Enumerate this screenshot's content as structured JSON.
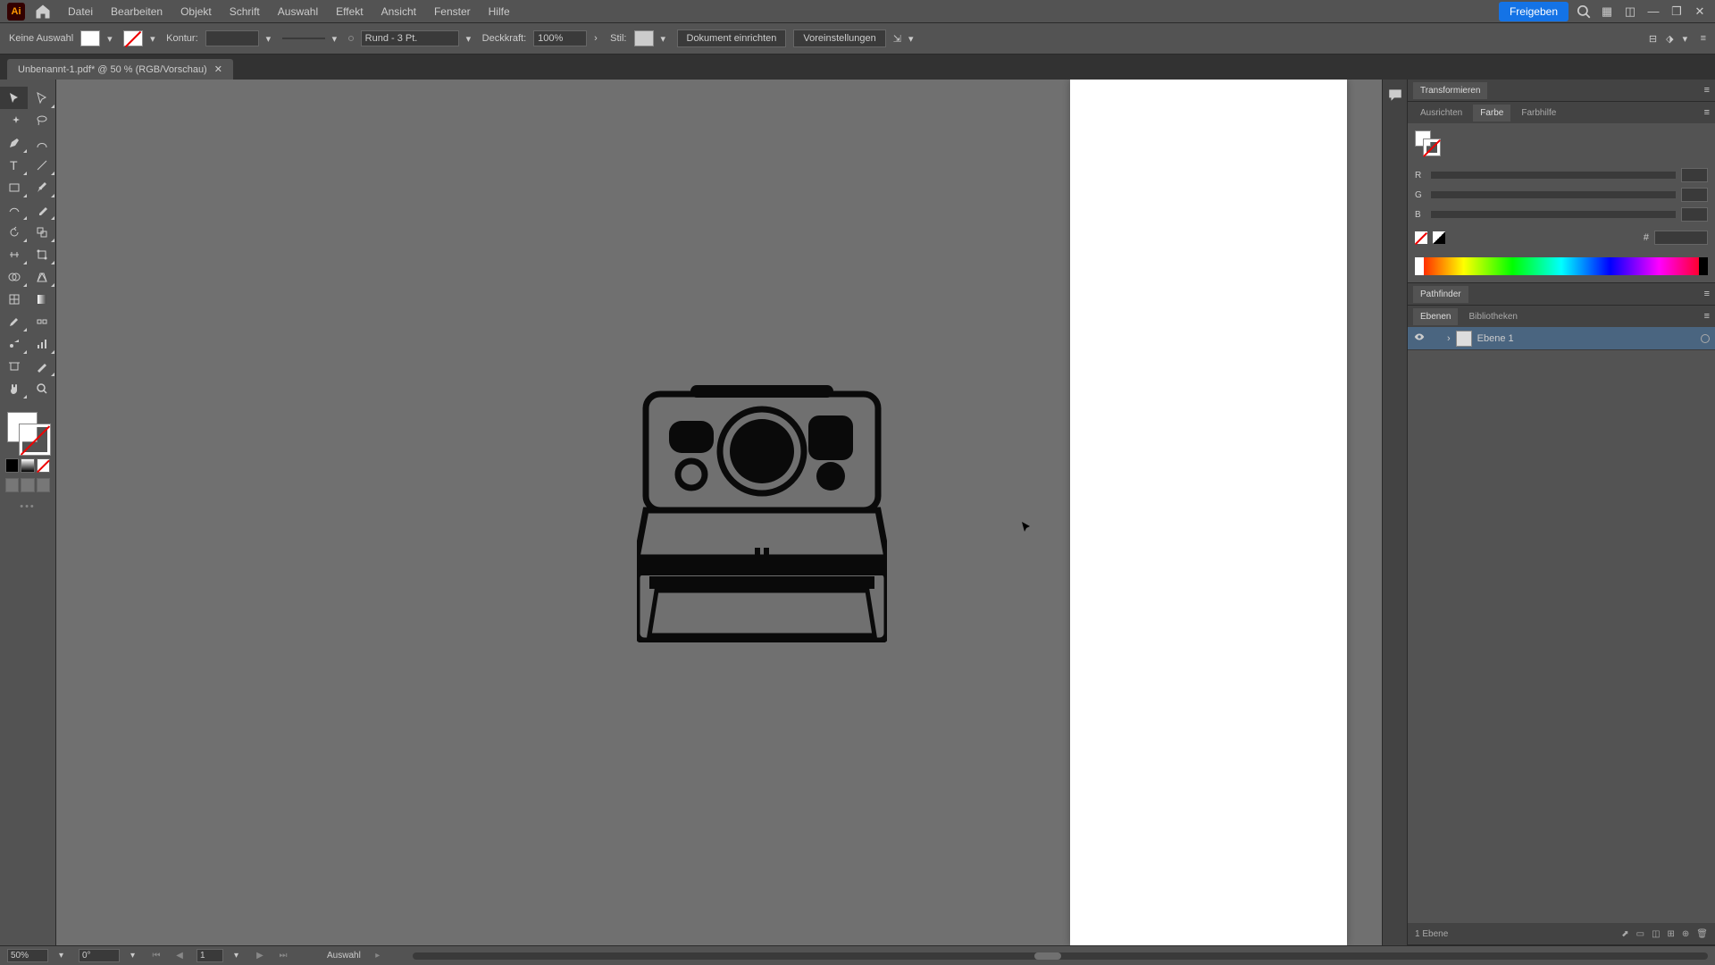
{
  "menubar": {
    "app_abbr": "Ai",
    "items": [
      "Datei",
      "Bearbeiten",
      "Objekt",
      "Schrift",
      "Auswahl",
      "Effekt",
      "Ansicht",
      "Fenster",
      "Hilfe"
    ],
    "share_label": "Freigeben"
  },
  "controlbar": {
    "selection_label": "Keine Auswahl",
    "stroke_label": "Kontur:",
    "brush_value": "Rund - 3 Pt.",
    "opacity_label": "Deckkraft:",
    "opacity_value": "100%",
    "style_label": "Stil:",
    "doc_setup": "Dokument einrichten",
    "preferences": "Voreinstellungen"
  },
  "doc": {
    "tab_title": "Unbenannt-1.pdf* @ 50 % (RGB/Vorschau)"
  },
  "panels": {
    "transform_title": "Transformieren",
    "align_tab": "Ausrichten",
    "color_tab": "Farbe",
    "color_guide_tab": "Farbhilfe",
    "rgb": {
      "r": "R",
      "g": "G",
      "b": "B"
    },
    "hex_symbol": "#",
    "pathfinder_title": "Pathfinder",
    "layers_tab": "Ebenen",
    "libraries_tab": "Bibliotheken",
    "layer1_name": "Ebene 1",
    "layers_count": "1 Ebene"
  },
  "status": {
    "zoom": "50%",
    "rotation": "0°",
    "artboard": "1",
    "tool": "Auswahl"
  }
}
